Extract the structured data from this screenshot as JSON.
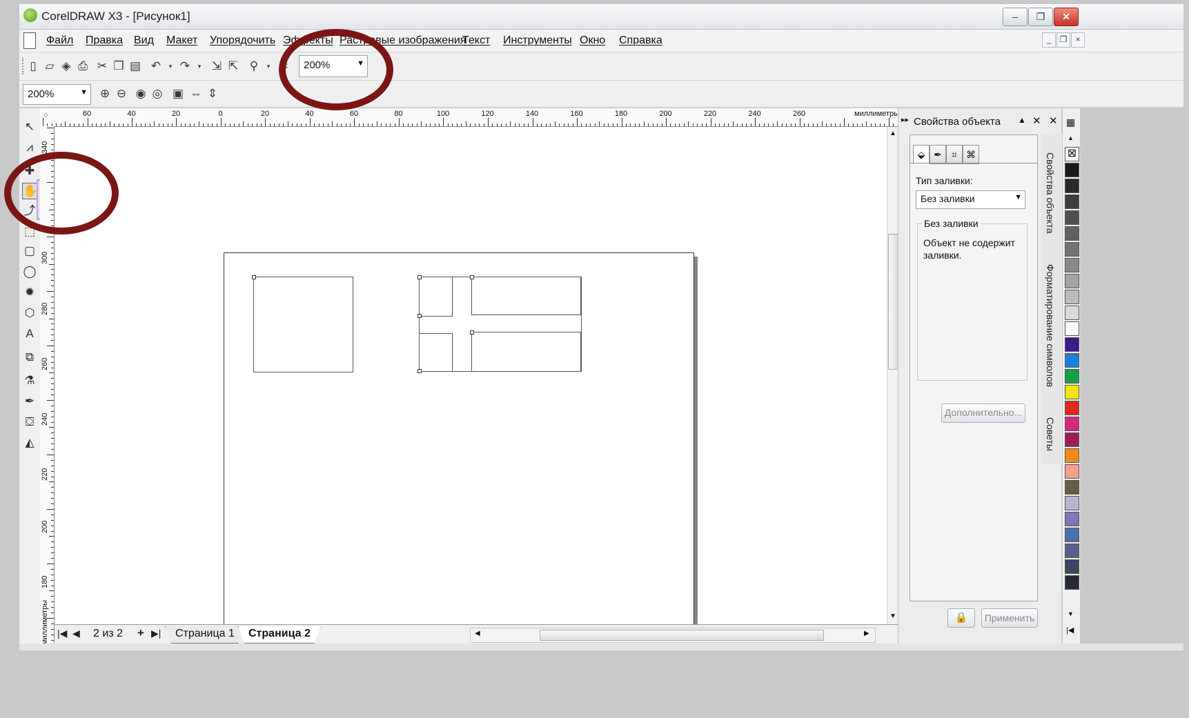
{
  "window": {
    "title": "CorelDRAW X3 - [Рисунок1]",
    "controls": {
      "minimize": "–",
      "restore": "❐",
      "close": "✕"
    }
  },
  "menu": {
    "items": [
      "Файл",
      "Правка",
      "Вид",
      "Макет",
      "Упорядочить",
      "Эффекты",
      "Растровые изображения",
      "Текст",
      "Инструменты",
      "Окно",
      "Справка"
    ]
  },
  "toolbar1": {
    "zoom_value": "200%"
  },
  "toolbar2": {
    "zoom_value": "200%"
  },
  "ruler": {
    "unit": "миллиметры",
    "h_labels": [
      "60",
      "40",
      "20",
      "0",
      "20",
      "40",
      "60",
      "80",
      "100",
      "120",
      "140",
      "160",
      "180",
      "200",
      "220",
      "240",
      "260"
    ],
    "v_labels": [
      "340",
      "300",
      "280",
      "260",
      "240",
      "220",
      "200",
      "180"
    ]
  },
  "pagebar": {
    "page_count": "2 из 2",
    "tabs": [
      "Страница 1",
      "Страница 2"
    ],
    "active_tab": "Страница 2"
  },
  "docker": {
    "title": "Свойства объекта",
    "fill_type_label": "Тип заливки:",
    "fill_type_value": "Без заливки",
    "group_title": "Без заливки",
    "description": "Объект не содержит заливки.",
    "more_button": "Дополнительно...",
    "apply_button": "Применить"
  },
  "side_tabs": [
    "Свойства объекта",
    "Форматирование символов",
    "Советы"
  ],
  "palette": {
    "colors": [
      "#1a1a1a",
      "#2b2b2b",
      "#3d3d3d",
      "#4f4f4f",
      "#616161",
      "#737373",
      "#8a8a8a",
      "#a3a3a3",
      "#bdbdbd",
      "#d9d9d9",
      "#ffffff",
      "#3b1a8a",
      "#1e7fd6",
      "#14a04a",
      "#f3e20c",
      "#e0281f",
      "#d6287c",
      "#a01d5a",
      "#f08a1c",
      "#f2a08e",
      "#6b5a46",
      "#b8b3d9",
      "#7e78b8",
      "#4c6fb0",
      "#55608a",
      "#3a4565",
      "#252a3a"
    ]
  },
  "colors": {
    "highlight_ring": "#7a1616",
    "flyout_border": "#b9a9d6"
  }
}
